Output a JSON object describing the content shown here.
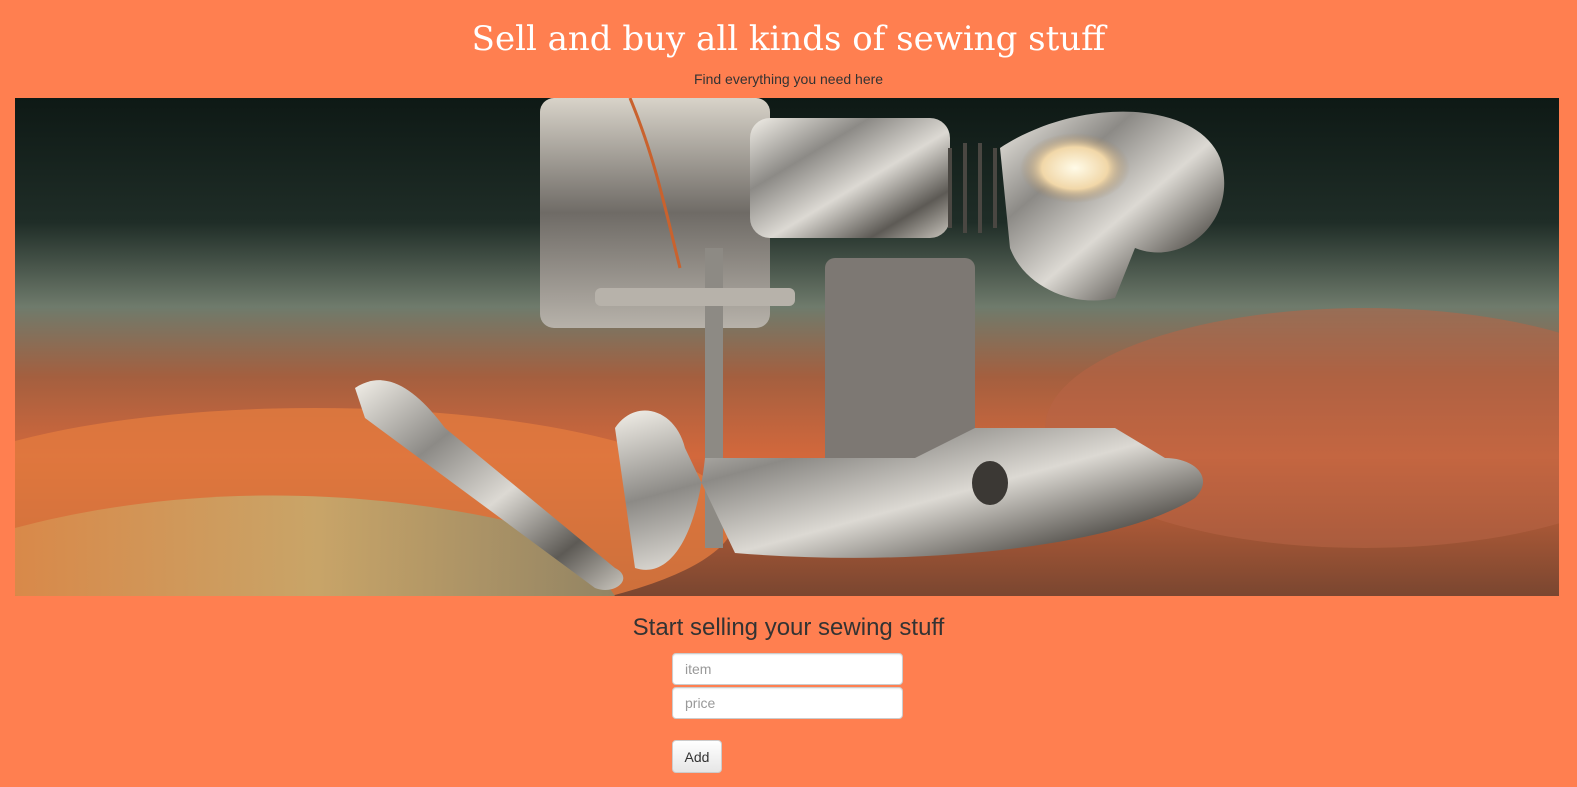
{
  "page": {
    "title": "Sell and buy all kinds of sewing stuff",
    "subtitle": "Find everything you need here",
    "background_color": "#ff7f50",
    "title_color": "#ffffff"
  },
  "hero": {
    "subject": "sewing-machine-presser-foot-photo"
  },
  "sell_form": {
    "heading": "Start selling your sewing stuff",
    "item_placeholder": "item",
    "item_value": "",
    "price_placeholder": "price",
    "price_value": "",
    "add_label": "Add"
  }
}
